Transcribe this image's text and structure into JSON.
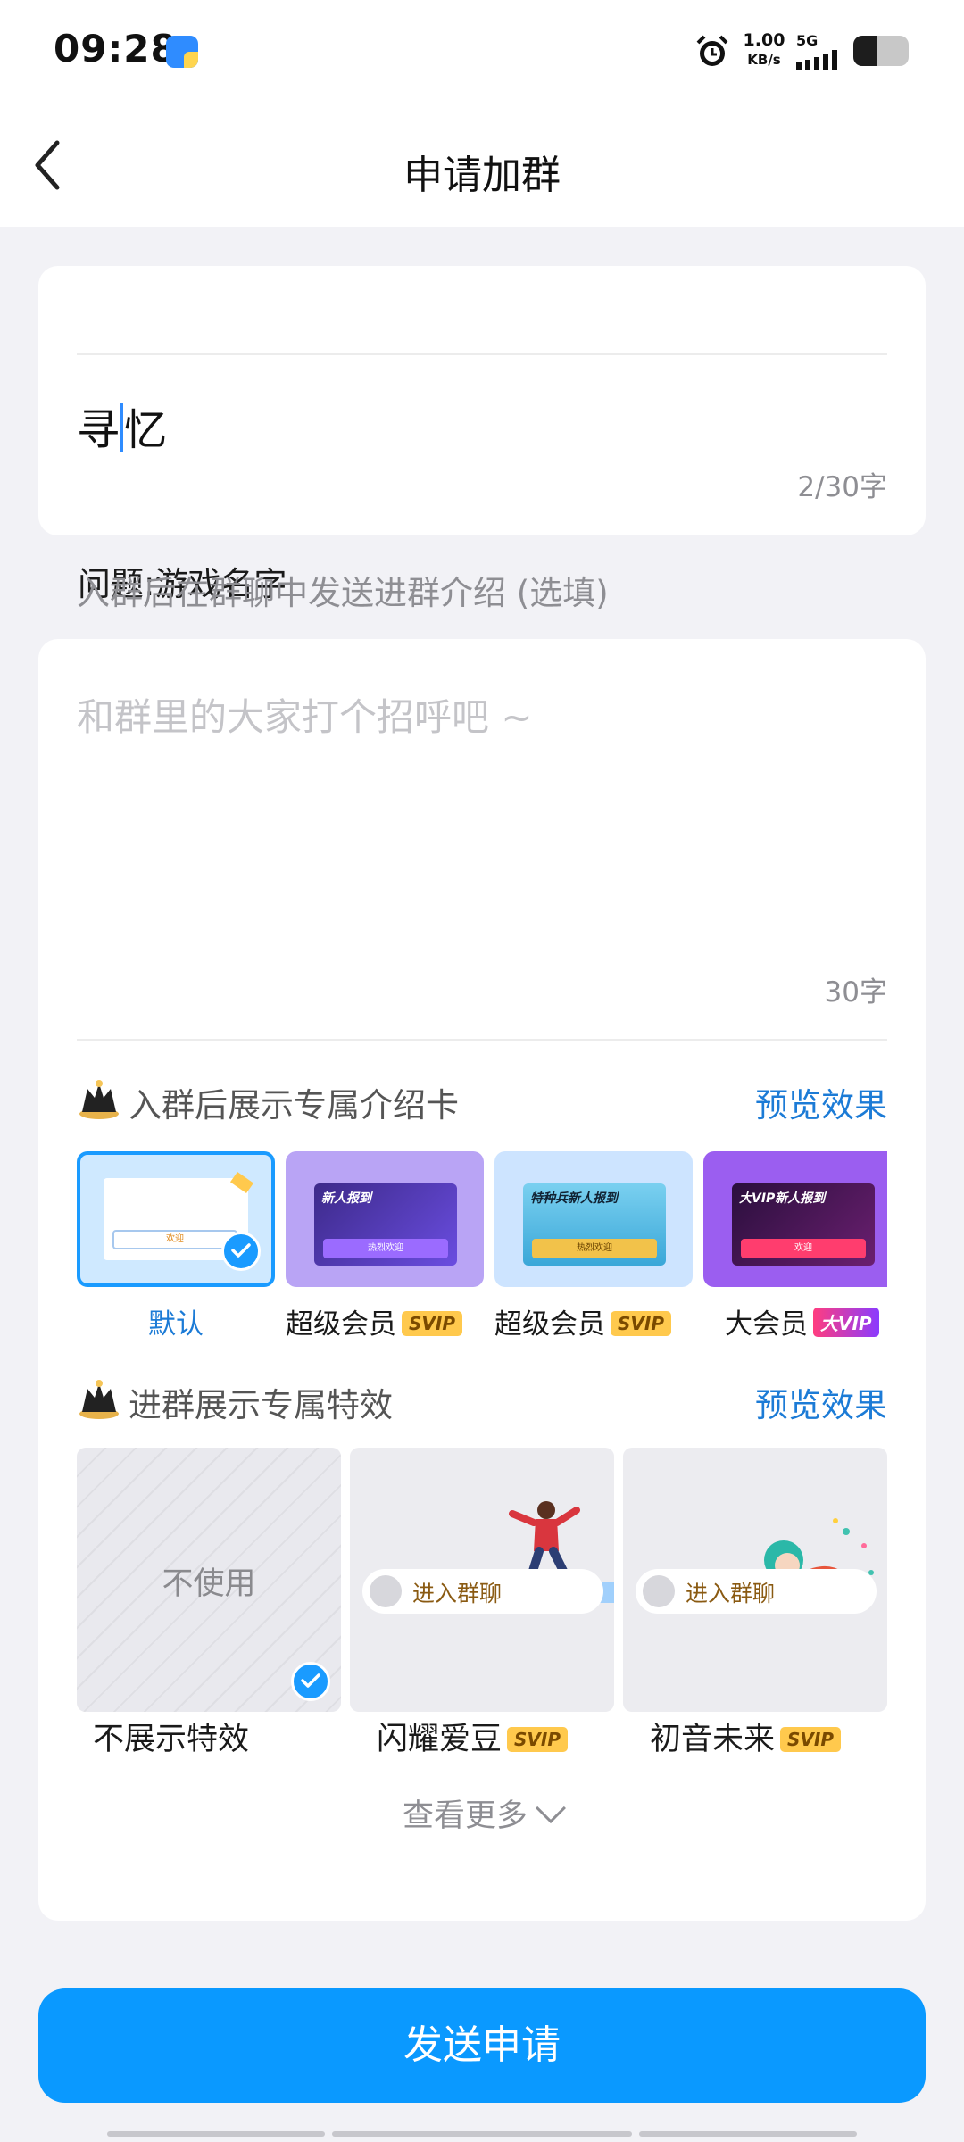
{
  "status_bar": {
    "time": "09:28",
    "net_speed_value": "1.00",
    "net_speed_unit": "KB/s",
    "network": "5G",
    "icons": [
      "app-icon",
      "alarm-icon",
      "signal-icon",
      "battery-icon"
    ]
  },
  "header": {
    "title": "申请加群",
    "back_icon": "chevron-left-icon"
  },
  "question": {
    "label": "问题:游戏名字",
    "answer_before_cursor": "寻",
    "answer_after_cursor": "忆",
    "counter": "2/30字"
  },
  "intro": {
    "hint": "入群后在群聊中发送进群介绍 (选填)",
    "placeholder": "和群里的大家打个招呼吧 ~",
    "counter": "30字"
  },
  "intro_cards": {
    "title": "入群后展示专属介绍卡",
    "preview_label": "预览效果",
    "items": [
      {
        "label": "默认",
        "badge": "",
        "selected": true,
        "preview_button": "欢迎"
      },
      {
        "label": "超级会员",
        "badge": "SVIP",
        "selected": false,
        "preview_title": "新人报到",
        "preview_button": "热烈欢迎"
      },
      {
        "label": "超级会员",
        "badge": "SVIP",
        "selected": false,
        "preview_title": "特种兵新人报到",
        "preview_button": "热烈欢迎"
      },
      {
        "label": "大会员",
        "badge": "大VIP",
        "selected": false,
        "preview_title": "大VIP新人报到",
        "preview_button": "欢迎"
      }
    ]
  },
  "effects": {
    "title": "进群展示专属特效",
    "preview_label": "预览效果",
    "items": [
      {
        "label": "不展示特效",
        "tile_text": "不使用",
        "badge": "",
        "selected": true
      },
      {
        "label": "闪耀爱豆",
        "pill_text": "进入群聊",
        "badge": "SVIP",
        "selected": false
      },
      {
        "label": "初音未来",
        "pill_text": "进入群聊",
        "badge": "SVIP",
        "selected": false
      }
    ],
    "more_label": "查看更多"
  },
  "send_button": "发送申请",
  "colors": {
    "accent": "#0a99ff",
    "link": "#1c7bd6",
    "background": "#f2f2f6",
    "svip_badge": "#ffc94d"
  }
}
